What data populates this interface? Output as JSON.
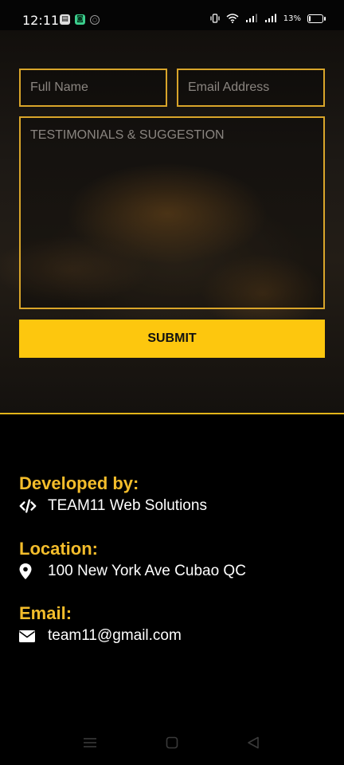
{
  "status_bar": {
    "time": "12:11",
    "battery_percent": "13%",
    "battery_level": 0.13,
    "icons": [
      "sim-card-icon",
      "app-notification-icon",
      "vpn-icon",
      "vibrate-icon",
      "wifi-icon",
      "signal-icon",
      "signal-icon",
      "battery-icon"
    ]
  },
  "form": {
    "name_placeholder": "Full Name",
    "email_placeholder": "Email Address",
    "message_placeholder": "TESTIMONIALS & SUGGESTION",
    "submit_label": "SUBMIT"
  },
  "footer": {
    "developed_heading": "Developed by:",
    "developed_text": "TEAM11 Web Solutions",
    "location_heading": "Location:",
    "location_text": "100 New York Ave Cubao QC",
    "email_heading": "Email:",
    "email_text": "team11@gmail.com"
  },
  "navigation_bar": {
    "buttons": [
      "menu-icon",
      "home-icon",
      "back-icon"
    ]
  },
  "colors": {
    "accent": "#fdc70e",
    "heading": "#f4bd2b",
    "field_border": "#d9a52a",
    "background": "#000000"
  }
}
